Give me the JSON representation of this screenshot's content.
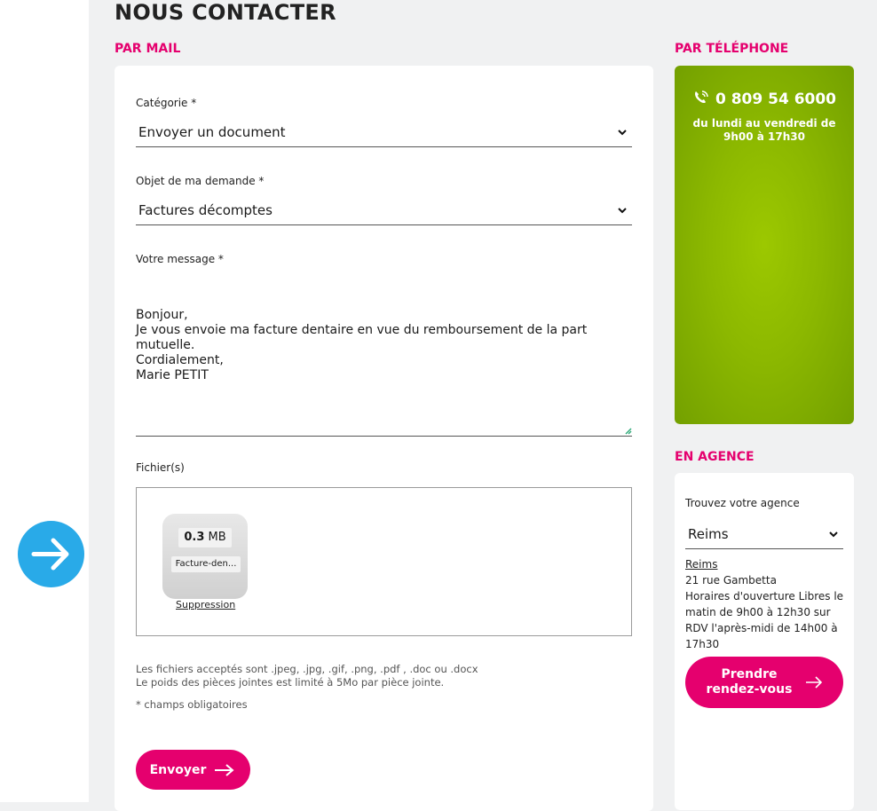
{
  "page_title": "NOUS CONTACTER",
  "sections": {
    "mail": "PAR MAIL",
    "phone": "PAR TÉLÉPHONE",
    "agency": "EN AGENCE"
  },
  "form": {
    "category_label": "Catégorie *",
    "category_value": "Envoyer un document",
    "subject_label": "Objet de ma demande *",
    "subject_value": "Factures décomptes",
    "message_label": "Votre message *",
    "message_value": "Bonjour,\nJe vous envoie ma facture dentaire en vue du remboursement de la part mutuelle.\nCordialement,\nMarie PETIT",
    "files_label": "Fichier(s)",
    "file": {
      "size_value": "0.3",
      "size_unit": "MB",
      "name": "Facture-den...",
      "remove_label": "Suppression"
    },
    "help_text": "Les fichiers acceptés sont .jpeg, .jpg, .gif, .png, .pdf , .doc ou .docx\nLe poids des pièces jointes est limité à 5Mo par pièce jointe.",
    "required_note": "* champs obligatoires",
    "submit_label": "Envoyer"
  },
  "phone": {
    "number": "0 809 54 6000",
    "hours": "du lundi au vendredi de\n9h00 à 17h30"
  },
  "agency": {
    "find_label": "Trouvez votre agence",
    "selected": "Reims",
    "name": "Reims",
    "address": "21 rue Gambetta",
    "hours": "Horaires d'ouverture Libres le matin de 9h00 à 12h30 sur RDV l'après-midi de 14h00 à 17h30",
    "appointment_label": "Prendre rendez-vous"
  },
  "colors": {
    "accent": "#e5006e",
    "phone_green": "#8cb800",
    "circle_blue": "#29aae8"
  }
}
